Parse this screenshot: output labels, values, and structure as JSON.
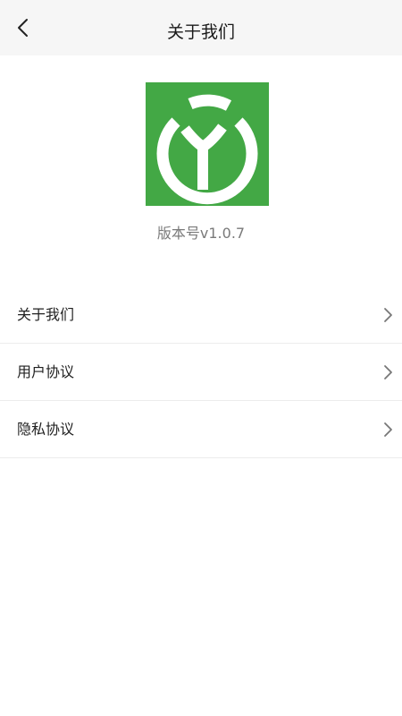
{
  "header": {
    "title": "关于我们",
    "back_icon": "chevron-left-icon"
  },
  "app": {
    "logo_icon": "app-logo",
    "logo_color": "#43a845",
    "version_text": "版本号v1.0.7"
  },
  "menu": {
    "items": [
      {
        "label": "关于我们",
        "icon": "chevron-right-icon"
      },
      {
        "label": "用户协议",
        "icon": "chevron-right-icon"
      },
      {
        "label": "隐私协议",
        "icon": "chevron-right-icon"
      }
    ]
  }
}
